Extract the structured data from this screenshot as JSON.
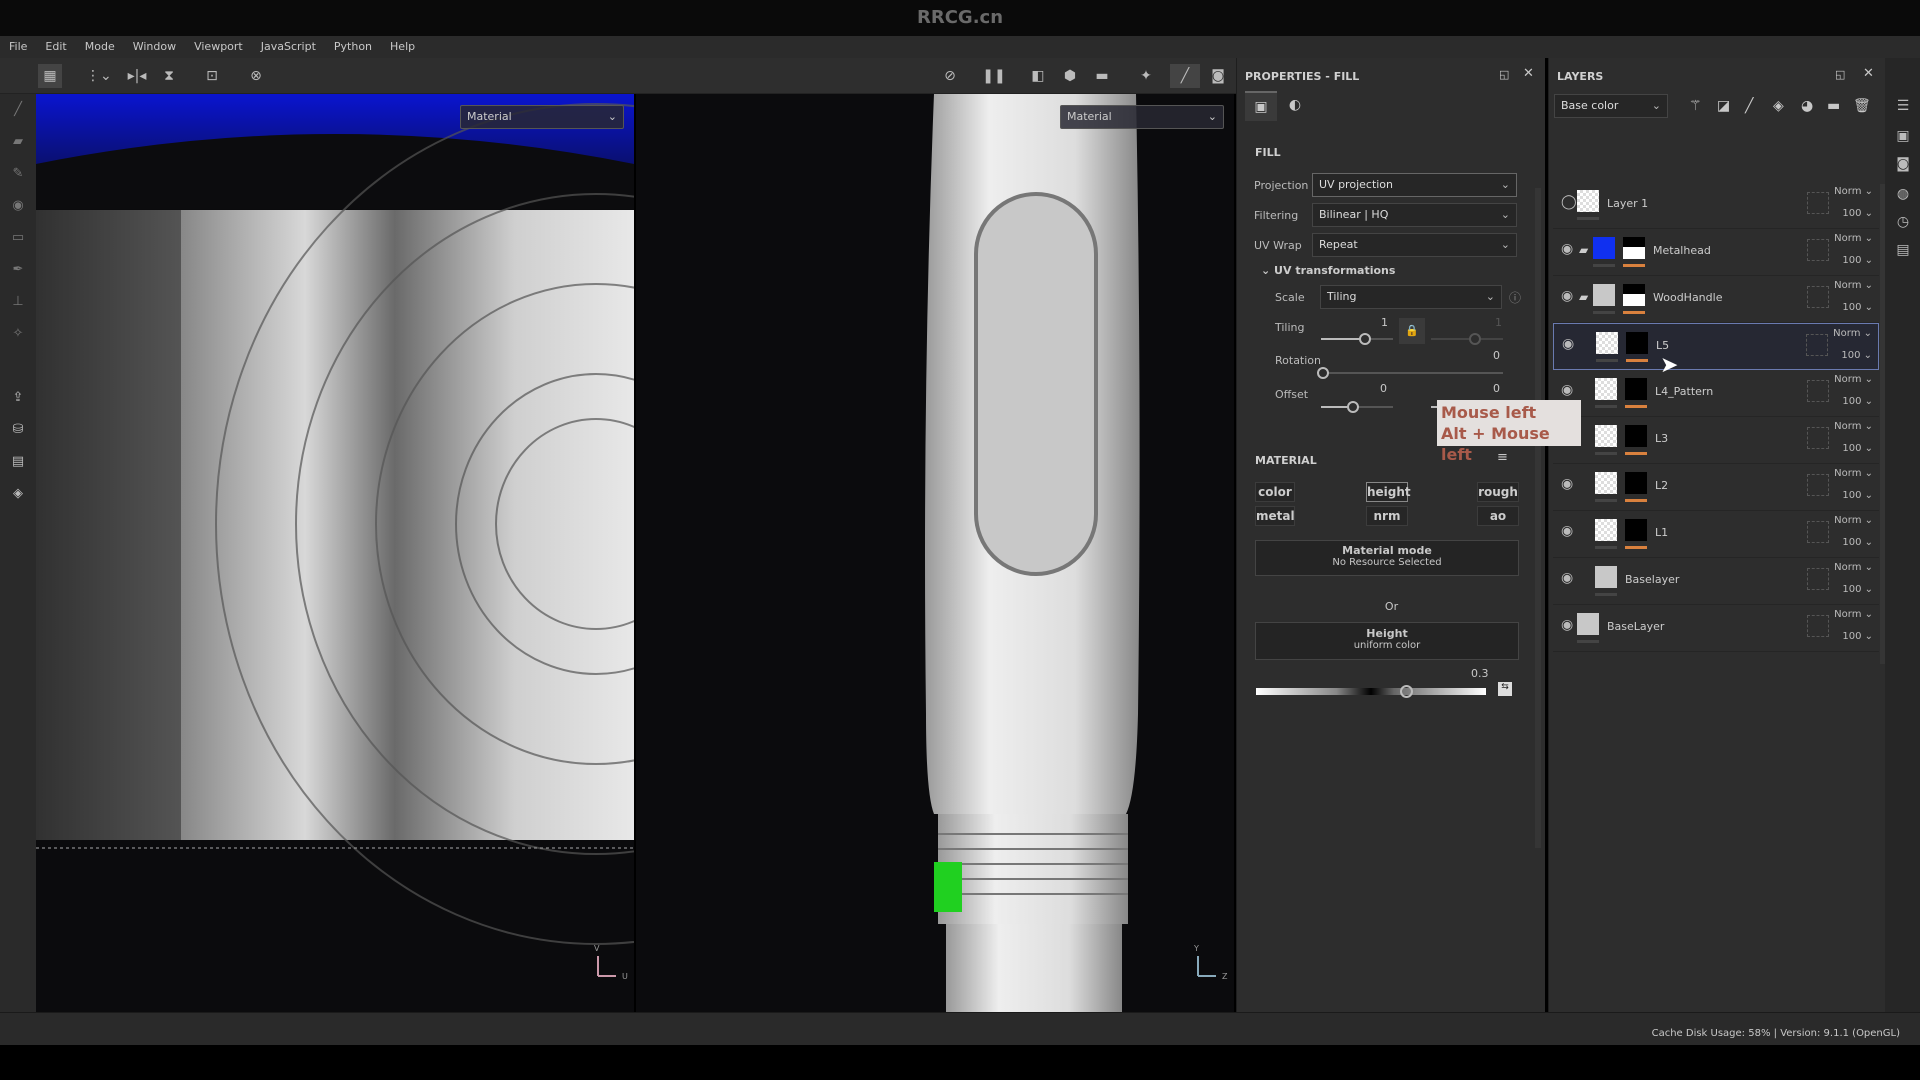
{
  "title": "RRCG.cn",
  "menu": [
    "File",
    "Edit",
    "Mode",
    "Window",
    "Viewport",
    "JavaScript",
    "Python",
    "Help"
  ],
  "viewport2d": {
    "mode_select": "Material",
    "axis_labels": [
      "V",
      "U"
    ]
  },
  "viewport3d": {
    "mode_select": "Material",
    "axis_labels": [
      "Y",
      "Z"
    ]
  },
  "properties": {
    "title": "PROPERTIES - FILL",
    "fill_heading": "FILL",
    "projection_label": "Projection",
    "projection_value": "UV projection",
    "filtering_label": "Filtering",
    "filtering_value": "Bilinear | HQ",
    "uvwrap_label": "UV Wrap",
    "uvwrap_value": "Repeat",
    "uv_transform_heading": "UV transformations",
    "scale_label": "Scale",
    "scale_value": "Tiling",
    "tiling_label": "Tiling",
    "tiling_u": "1",
    "tiling_v": "1",
    "rotation_label": "Rotation",
    "rotation_value": "0",
    "offset_label": "Offset",
    "offset_u": "0",
    "offset_v": "0",
    "material_heading": "MATERIAL",
    "channels": [
      "color",
      "height",
      "rough",
      "metal",
      "nrm",
      "ao"
    ],
    "active_channel": "height",
    "material_mode_title": "Material mode",
    "material_mode_sub": "No Resource Selected",
    "or_label": "Or",
    "height_title": "Height",
    "height_sub": "uniform color",
    "height_value": "0.3"
  },
  "tooltip": {
    "line1": "Mouse left",
    "line2": "Alt + Mouse left"
  },
  "layers": {
    "title": "LAYERS",
    "channel_select": "Base color",
    "items": [
      {
        "name": "Layer 1",
        "blend": "Norm",
        "opacity": "100",
        "color": "checker"
      },
      {
        "name": "Metalhead",
        "blend": "Norm",
        "opacity": "100",
        "color": "#1030f0",
        "folder": true
      },
      {
        "name": "WoodHandle",
        "blend": "Norm",
        "opacity": "100",
        "color": "#c8c8c8",
        "folder": true
      },
      {
        "name": "L5",
        "blend": "Norm",
        "opacity": "100",
        "color": "checker",
        "selected": true
      },
      {
        "name": "L4_Pattern",
        "blend": "Norm",
        "opacity": "100",
        "color": "checker"
      },
      {
        "name": "L3",
        "blend": "Norm",
        "opacity": "100",
        "color": "checker"
      },
      {
        "name": "L2",
        "blend": "Norm",
        "opacity": "100",
        "color": "checker"
      },
      {
        "name": "L1",
        "blend": "Norm",
        "opacity": "100",
        "color": "checker"
      },
      {
        "name": "Baselayer",
        "blend": "Norm",
        "opacity": "100",
        "color": "#c8c8c8"
      },
      {
        "name": "BaseLayer",
        "blend": "Norm",
        "opacity": "100",
        "color": "#c8c8c8"
      }
    ]
  },
  "status": {
    "cache_label": "Cache Disk Usage:",
    "cache_value": "58%",
    "version": "| Version: 9.1.1 (OpenGL)"
  },
  "colors": {
    "accent_orange": "#d9813e",
    "metalhead_blue": "#1030f0",
    "viewport_blue": "#0a14c8",
    "uv_marker_green": "#20d020"
  }
}
